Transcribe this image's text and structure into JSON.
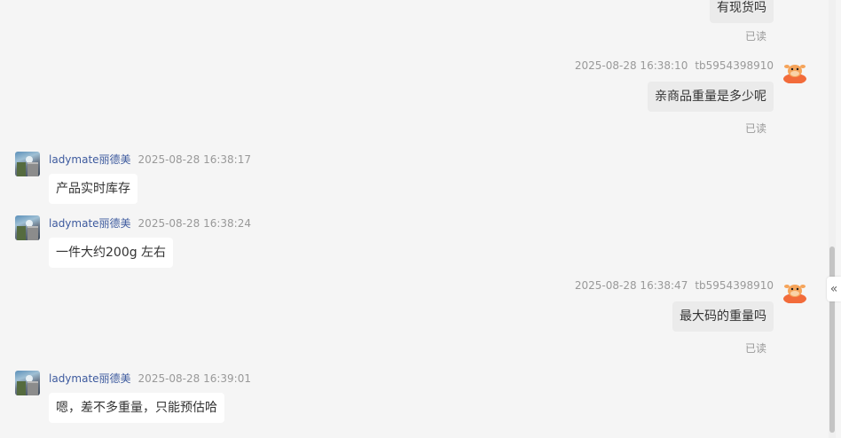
{
  "messages": [
    {
      "dir": "out",
      "text": "有现货吗",
      "read": "已读"
    },
    {
      "dir": "out",
      "time": "2025-08-28 16:38:10",
      "sender": "tb5954398910",
      "avatar": "cow-mascot-avatar",
      "text": "亲商品重量是多少呢",
      "read": "已读"
    },
    {
      "dir": "in",
      "sender": "ladymate丽德美",
      "time": "2025-08-28 16:38:17",
      "avatar": "shop-photo-avatar",
      "text": "产品实时库存"
    },
    {
      "dir": "in",
      "sender": "ladymate丽德美",
      "time": "2025-08-28 16:38:24",
      "avatar": "shop-photo-avatar",
      "text": "一件大约200g 左右"
    },
    {
      "dir": "out",
      "time": "2025-08-28 16:38:47",
      "sender": "tb5954398910",
      "avatar": "cow-mascot-avatar",
      "text": "最大码的重量吗",
      "read": "已读"
    },
    {
      "dir": "in",
      "sender": "ladymate丽德美",
      "time": "2025-08-28 16:39:01",
      "avatar": "shop-photo-avatar",
      "text": "嗯，差不多重量，只能预估哈"
    }
  ],
  "ui": {
    "collapse_icon": "«",
    "collapse_name": "double-chevron-left-icon"
  },
  "colors": {
    "background": "#f5f5f5",
    "incoming_bubble": "#ffffff",
    "outgoing_bubble": "#ebebeb",
    "nickname": "#3d5a9e",
    "meta": "#999999"
  }
}
